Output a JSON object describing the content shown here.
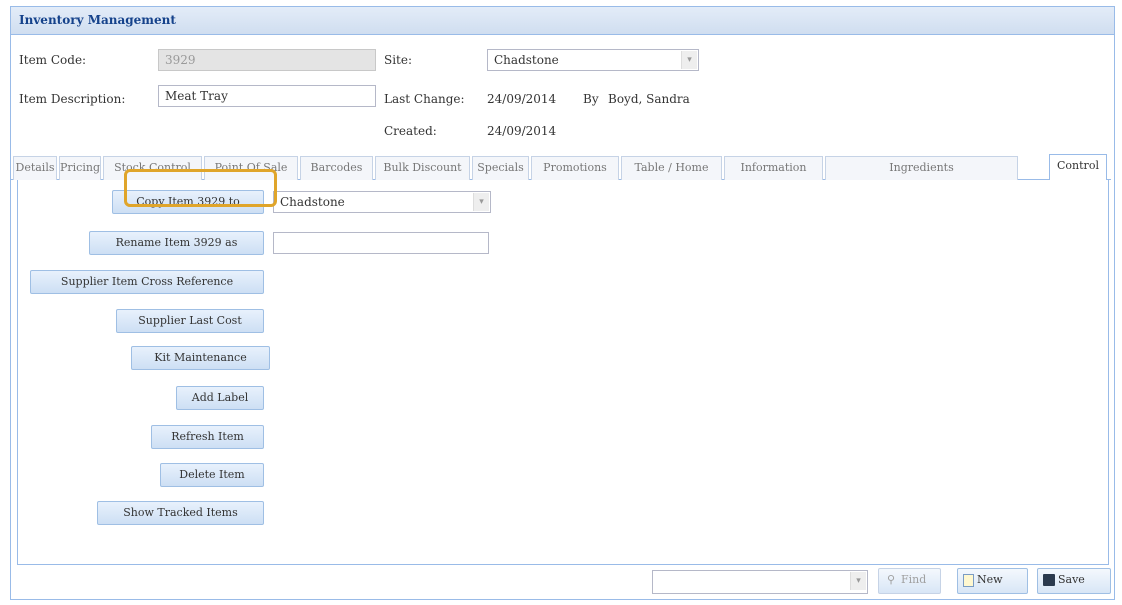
{
  "window": {
    "title": "Inventory Management"
  },
  "header": {
    "item_code_label": "Item Code:",
    "item_code_value": "3929",
    "item_desc_label": "Item Description:",
    "item_desc_value": "Meat Tray",
    "site_label": "Site:",
    "site_value": "Chadstone",
    "last_change_label": "Last Change:",
    "last_change_date": "24/09/2014",
    "by_label": "By",
    "by_value": "Boyd, Sandra",
    "created_label": "Created:",
    "created_date": "24/09/2014"
  },
  "tabs": [
    {
      "label": "Details"
    },
    {
      "label": "Pricing"
    },
    {
      "label": "Stock Control"
    },
    {
      "label": "Point Of Sale"
    },
    {
      "label": "Barcodes"
    },
    {
      "label": "Bulk Discount"
    },
    {
      "label": "Specials"
    },
    {
      "label": "Promotions"
    },
    {
      "label": "Table / Home"
    },
    {
      "label": "Information"
    },
    {
      "label": "Ingredients"
    },
    {
      "label": "Control"
    }
  ],
  "active_tab": "Control",
  "control": {
    "copy_button": "Copy Item 3929 to",
    "copy_site": "Chadstone",
    "rename_button": "Rename Item 3929 as",
    "rename_value": "",
    "buttons": [
      "Supplier Item Cross Reference",
      "Supplier Last Cost",
      "Kit Maintenance",
      "Add Label",
      "Refresh Item",
      "Delete Item",
      "Show Tracked Items"
    ],
    "highlighted_button": "Kit Maintenance"
  },
  "footer": {
    "search_value": "",
    "find_label": "Find",
    "new_label": "New",
    "save_label": "Save"
  },
  "colors": {
    "accent_border": "#99bbe8",
    "title_text": "#15428b",
    "highlight": "#e0a52a"
  },
  "icons": {
    "find": "magnifier-icon",
    "new": "new-document-icon",
    "save": "floppy-disk-icon",
    "combo": "chevron-down-icon"
  }
}
